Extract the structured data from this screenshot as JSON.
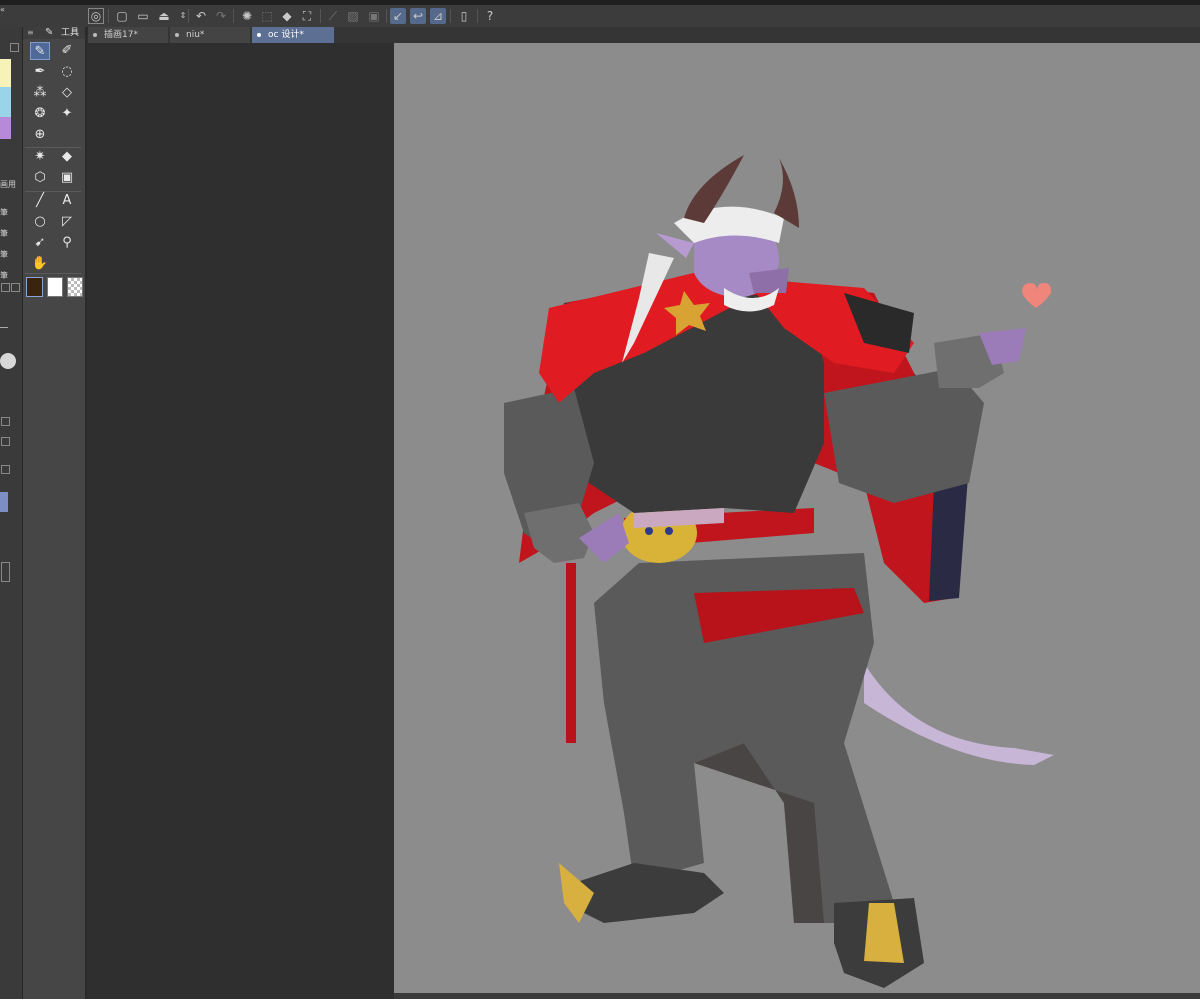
{
  "tabs": [
    {
      "label": "插画17*"
    },
    {
      "label": "niu*"
    },
    {
      "label": "oc 设计*"
    }
  ],
  "active_tab": "oc 设计*",
  "tool_panel": {
    "title": "工具",
    "text_tool_label": "A"
  },
  "left_strip": {
    "labels": [
      "画用",
      "筆",
      "筆",
      "筆",
      "筆"
    ],
    "swatch_colors": [
      "#f7f2b8",
      "#9ad4e8",
      "#b68ad8"
    ]
  },
  "colors": {
    "main_color": "#3a2410",
    "sub_color": "#ffffff",
    "accent": "#55698c"
  },
  "toolbar_icons": [
    "new-canvas-icon",
    "open-file-icon",
    "save-icon",
    "undo-icon",
    "redo-icon",
    "loading-icon",
    "select-all-icon",
    "fill-icon",
    "transform-icon",
    "ruler-icon",
    "grid-icon",
    "snap-icon",
    "pen-stroke-icon",
    "perspective-icon",
    "device-icon",
    "help-icon"
  ],
  "canvas": {
    "background": "#8c8c8c",
    "content": "character design illustration"
  }
}
